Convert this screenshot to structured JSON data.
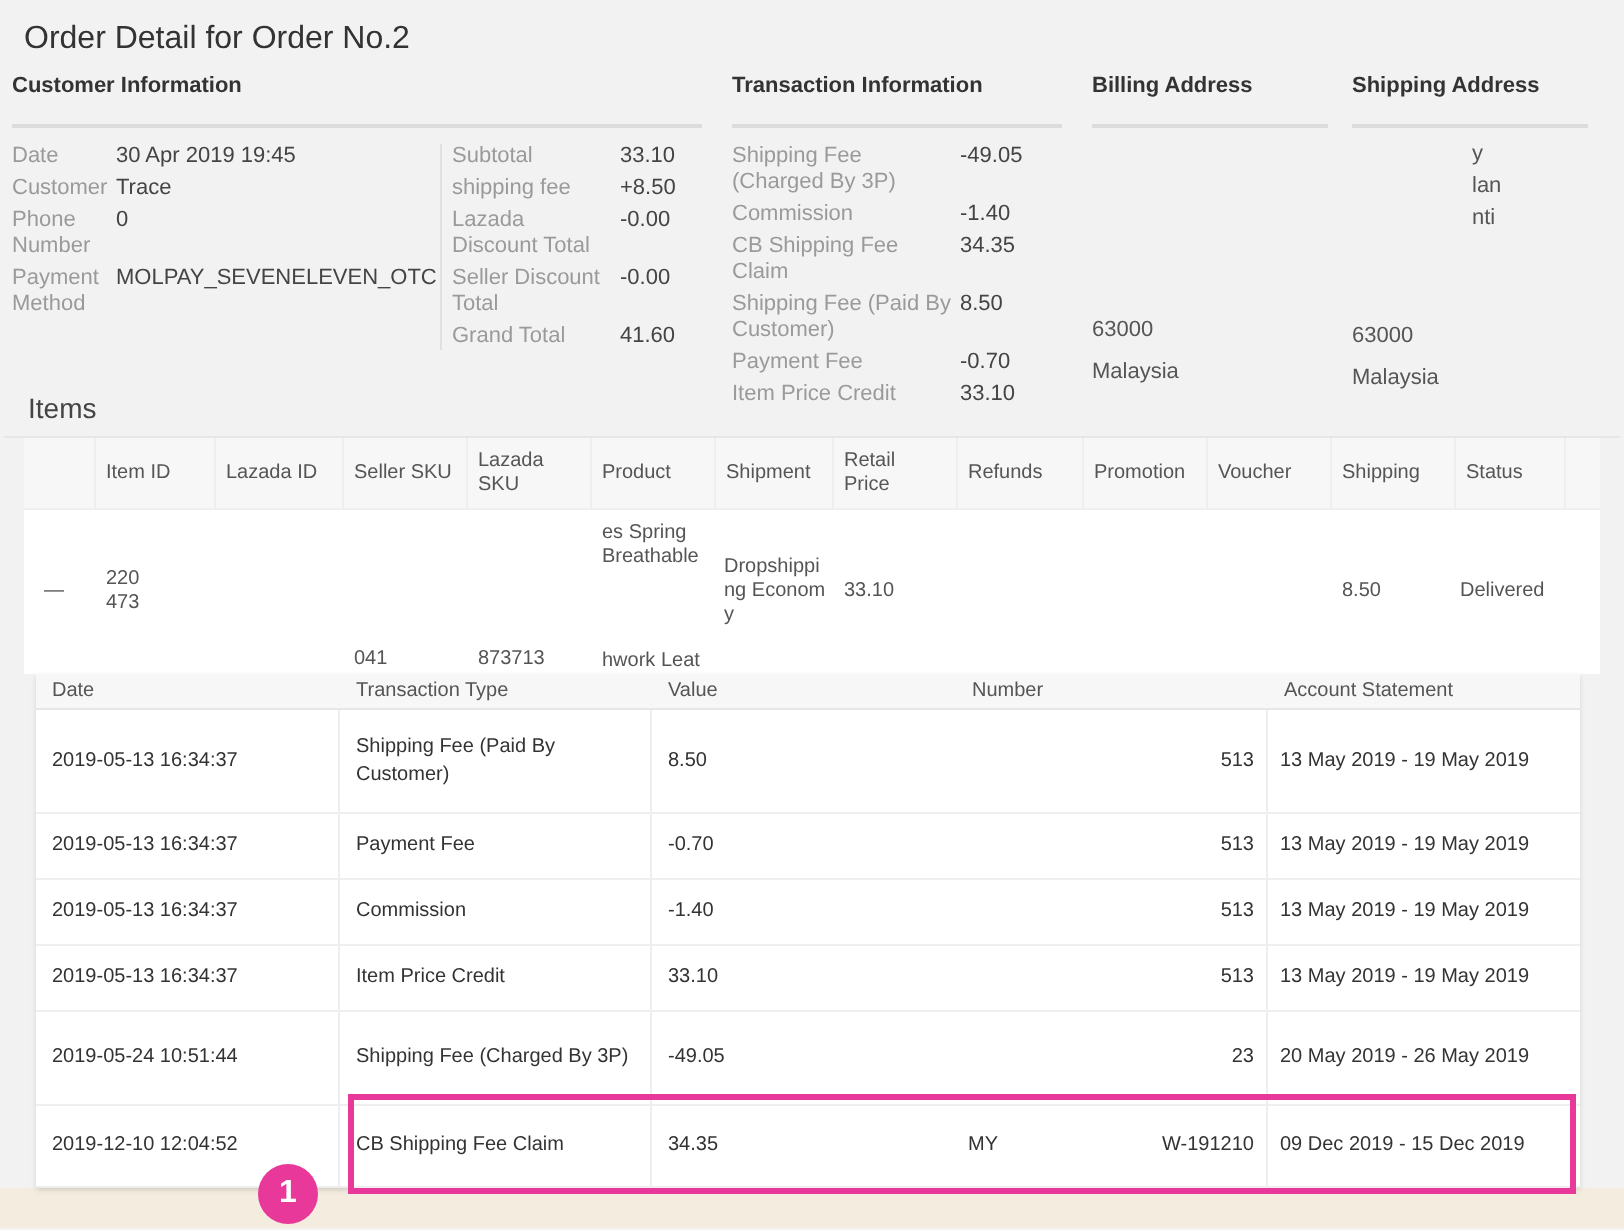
{
  "title": "Order Detail for Order No.2",
  "customer": {
    "header": "Customer Information",
    "fields": [
      {
        "label": "Date",
        "value": "30 Apr 2019 19:45"
      },
      {
        "label": "Customer",
        "value": "Trace"
      },
      {
        "label": "Phone Number",
        "value": "0"
      },
      {
        "label": "Payment Method",
        "value": "MOLPAY_SEVENELEVEN_OTC"
      }
    ],
    "totals": [
      {
        "label": "Subtotal",
        "value": "33.10"
      },
      {
        "label": "shipping fee",
        "value": "+8.50"
      },
      {
        "label": "Lazada Discount Total",
        "value": "-0.00"
      },
      {
        "label": "Seller Discount Total",
        "value": "-0.00"
      },
      {
        "label": "Grand Total",
        "value": "41.60"
      }
    ]
  },
  "transaction": {
    "header": "Transaction Information",
    "fields": [
      {
        "label": "Shipping Fee (Charged By 3P)",
        "value": "-49.05"
      },
      {
        "label": "Commission",
        "value": "-1.40"
      },
      {
        "label": "CB Shipping Fee Claim",
        "value": "34.35"
      },
      {
        "label": "Shipping Fee (Paid By Customer)",
        "value": "8.50"
      },
      {
        "label": "Payment Fee",
        "value": "-0.70"
      },
      {
        "label": "Item Price Credit",
        "value": "33.10"
      }
    ]
  },
  "billing": {
    "header": "Billing Address",
    "lines": [
      "63000",
      "Malaysia"
    ]
  },
  "shipping": {
    "header": "Shipping Address",
    "fragments": [
      "y",
      "lan",
      "nti"
    ],
    "lines": [
      "63000",
      "Malaysia"
    ]
  },
  "items": {
    "title": "Items",
    "columns": [
      "",
      "Item ID",
      "Lazada ID",
      "Seller SKU",
      "Lazada SKU",
      "Product",
      "Shipment",
      "Retail Price",
      "Refunds",
      "Promotion",
      "Voucher",
      "Shipping",
      "Status"
    ],
    "row": {
      "expand": "—",
      "item_id": "220 473",
      "seller_sku": "041",
      "lazada_sku": "873713",
      "product_top": "es Spring Breathable",
      "product_bottom": "hwork Leat",
      "shipment": "Dropshipping Economy",
      "retail_price": "33.10",
      "shipping": "8.50",
      "status": "Delivered"
    }
  },
  "transactions": {
    "columns": [
      "Date",
      "Transaction Type",
      "Value",
      "Number",
      "Account Statement"
    ],
    "rows": [
      {
        "date": "2019-05-13 16:34:37",
        "type": "Shipping Fee (Paid By Customer)",
        "value": "8.50",
        "number": [
          "513"
        ],
        "statement": "13 May 2019 - 19 May 2019",
        "highlighted": false
      },
      {
        "date": "2019-05-13 16:34:37",
        "type": "Payment Fee",
        "value": "-0.70",
        "number": [
          "513"
        ],
        "statement": "13 May 2019 - 19 May 2019",
        "highlighted": false
      },
      {
        "date": "2019-05-13 16:34:37",
        "type": "Commission",
        "value": "-1.40",
        "number": [
          "513"
        ],
        "statement": "13 May 2019 - 19 May 2019",
        "highlighted": false
      },
      {
        "date": "2019-05-13 16:34:37",
        "type": "Item Price Credit",
        "value": "33.10",
        "number": [
          "513"
        ],
        "statement": "13 May 2019 - 19 May 2019",
        "highlighted": false
      },
      {
        "date": "2019-05-24 10:51:44",
        "type": "Shipping Fee (Charged By 3P)",
        "value": "-49.05",
        "number": [
          "23"
        ],
        "statement": "20 May 2019 - 26 May 2019",
        "highlighted": false
      },
      {
        "date": "2019-12-10 12:04:52",
        "type": "CB Shipping Fee Claim",
        "value": "34.35",
        "number": [
          "MY",
          "W-191210"
        ],
        "statement": "09 Dec 2019 - 15 Dec 2019",
        "highlighted": true
      }
    ]
  },
  "badge": "1"
}
